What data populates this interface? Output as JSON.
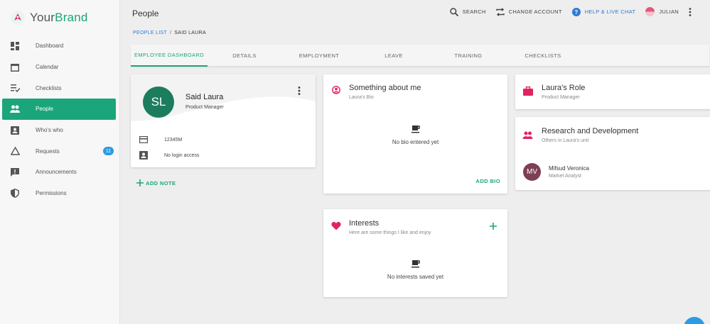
{
  "brand": {
    "name_plain": "Your",
    "name_accent": "Brand"
  },
  "sidebar": {
    "items": [
      {
        "label": "Dashboard",
        "icon": "dashboard-icon"
      },
      {
        "label": "Calendar",
        "icon": "calendar-icon"
      },
      {
        "label": "Checklists",
        "icon": "checklist-icon"
      },
      {
        "label": "People",
        "icon": "people-icon",
        "active": true
      },
      {
        "label": "Who's who",
        "icon": "contact-card-icon"
      },
      {
        "label": "Requests",
        "icon": "triangle-icon",
        "badge": "11"
      },
      {
        "label": "Announcements",
        "icon": "announcement-icon"
      },
      {
        "label": "Permissions",
        "icon": "shield-icon"
      }
    ]
  },
  "header": {
    "title": "People",
    "search": "SEARCH",
    "change_account": "CHANGE ACCOUNT",
    "help": "HELP & LIVE CHAT",
    "user": "JULIAN"
  },
  "breadcrumb": {
    "parent": "PEOPLE LIST",
    "current": "SAID LAURA"
  },
  "tabs": [
    "EMPLOYEE DASHBOARD",
    "DETAILS",
    "EMPLOYMENT",
    "LEAVE",
    "TRAINING",
    "CHECKLISTS"
  ],
  "profile": {
    "initials": "SL",
    "name": "Said Laura",
    "title": "Product Manager",
    "id": "12345M",
    "login": "No login access",
    "add_note": "ADD NOTE"
  },
  "about": {
    "title": "Something about me",
    "subtitle": "Laura's Bio",
    "empty": "No bio entered yet",
    "action": "ADD BIO"
  },
  "interests": {
    "title": "Interests",
    "subtitle": "Here are some things I like and enjoy",
    "empty": "No interests saved yet"
  },
  "role": {
    "title": "Laura's Role",
    "subtitle": "Product Manager"
  },
  "unit": {
    "title": "Research and Development",
    "subtitle": "Others in Laura's unit",
    "member_initials": "MV",
    "member_name": "Mifsud Veronica",
    "member_role": "Market Analyst"
  },
  "colors": {
    "accent": "#1aa57a",
    "link": "#2b7bd6",
    "danger": "#e0245e"
  }
}
